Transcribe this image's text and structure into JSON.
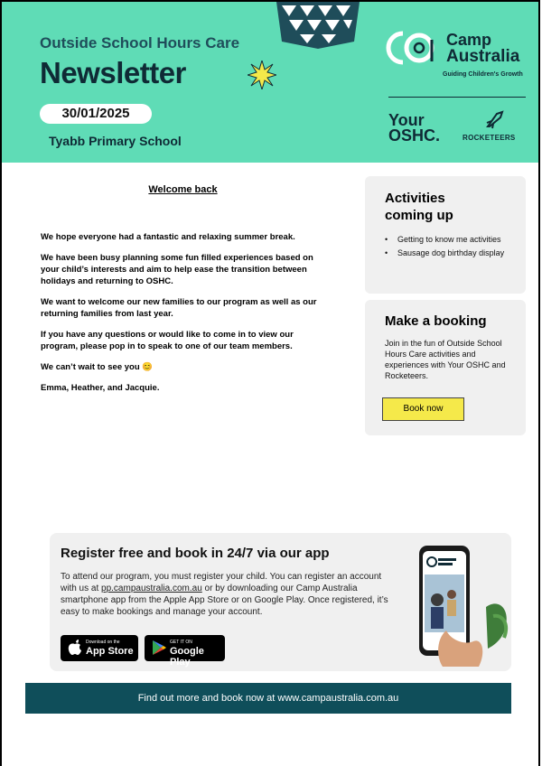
{
  "header": {
    "pre_title": "Outside School Hours Care",
    "title": "Newsletter",
    "date": "30/01/2025",
    "school": "Tyabb Primary School",
    "brand": {
      "name_line1": "Camp",
      "name_line2": "Australia",
      "tagline": "Guiding Children's Growth",
      "logo_icon": "camp-australia-logo-icon"
    },
    "partners": {
      "your_oshc_line1": "Your",
      "your_oshc_line2": "OSHC.",
      "rocketeers": "ROCKETEERS"
    },
    "colors": {
      "background": "#5fdcb6",
      "text": "#0f2a35"
    }
  },
  "welcome": {
    "title": "Welcome back",
    "paragraphs": [
      "We hope everyone had a fantastic and relaxing summer break.",
      "We have been busy planning some fun filled experiences based on your child’s interests and aim to help ease the transition between holidays and returning to OSHC.",
      "We want to welcome our new families to our program as well as our returning families from last year.",
      "If you have any questions or would like to come in to view our program, please pop in to speak to one of our team members.",
      "We can’t wait to see you 😊",
      "Emma, Heather, and Jacquie."
    ]
  },
  "activities": {
    "title": "Activities coming up",
    "items": [
      "Getting to know me activities",
      "Sausage dog birthday display"
    ]
  },
  "booking": {
    "title": "Make a booking",
    "body": "Join in the fun of Outside School Hours Care activities and experiences with Your OSHC and Rocketeers.",
    "button": "Book now",
    "button_color": "#f5e94a"
  },
  "app_promo": {
    "title": "Register free and book in 24/7 via our app",
    "body_before_link": "To attend our program, you must register your child. You can register an account with us at ",
    "link": "pp.campaustralia.com.au",
    "body_after_link": " or by downloading our Camp Australia smartphone app from the Apple App Store or on Google Play. Once registered, it’s easy to make bookings and manage your account.",
    "app_store": {
      "small": "Download on the",
      "big": "App Store"
    },
    "google_play": {
      "small": "GET IT ON",
      "big": "Google Play"
    }
  },
  "footer": {
    "text": "Find out more and book now at www.campaustralia.com.au",
    "color": "#0f4e5a"
  }
}
